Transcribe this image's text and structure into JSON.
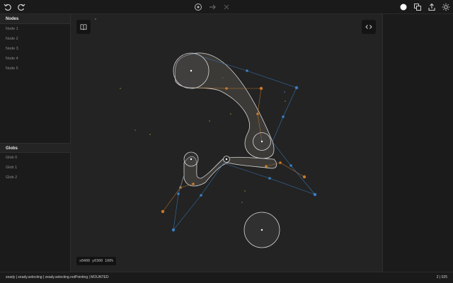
{
  "toolbar": {
    "left_icons": [
      "undo-icon",
      "redo-icon"
    ],
    "center_icons": [
      "target-icon",
      "arrow-right-icon",
      "close-icon"
    ],
    "right_icons": [
      "theme-dot-icon",
      "copy-icon",
      "share-icon",
      "sun-icon"
    ]
  },
  "nodes": {
    "header": "Nodes",
    "items": [
      "Node 1",
      "Node 2",
      "Node 3",
      "Node 4",
      "Node 5"
    ]
  },
  "globs": {
    "header": "Globs",
    "items": [
      "Glob 0",
      "Glob 1",
      "Glob 2"
    ]
  },
  "canvas": {
    "book_icon": "book-icon",
    "code_icon": "code-icon",
    "coords": "x0400 y0300 100%"
  },
  "status": {
    "left": "zeady | zeady.selecting | zeady.selecting.notPointing | MOUNTED",
    "right": "2 | 025"
  },
  "colors": {
    "accent_orange": "#c97a2a",
    "accent_blue": "#3a7fc4",
    "glob_fill": "#5a5650",
    "node_stroke": "#d8d8d8"
  }
}
